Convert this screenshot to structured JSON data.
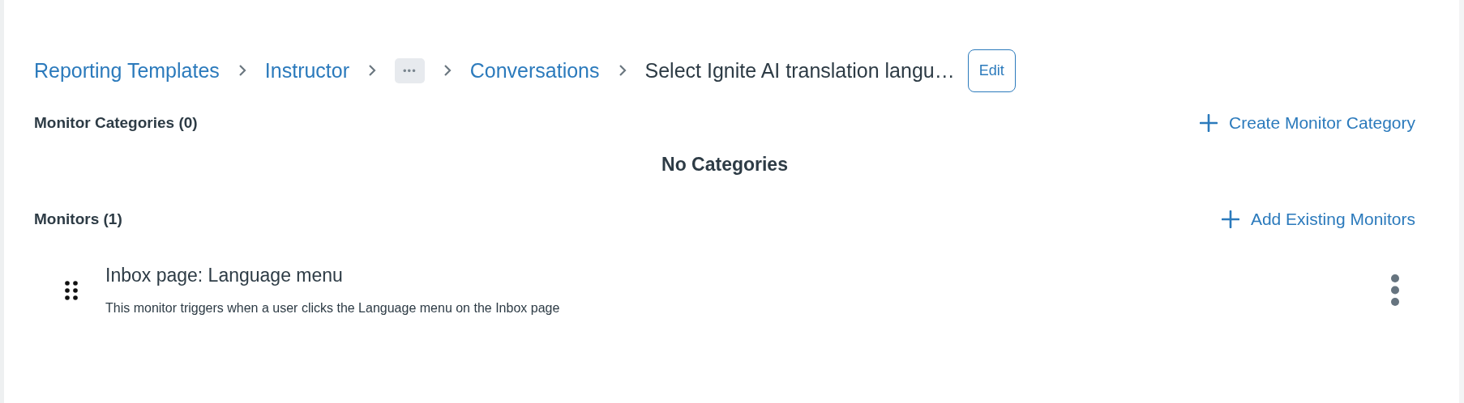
{
  "breadcrumb": [
    {
      "kind": "link",
      "label": "Reporting Templates"
    },
    {
      "kind": "link",
      "label": "Instructor"
    },
    {
      "kind": "ellipsis",
      "label": "•••"
    },
    {
      "kind": "link",
      "label": "Conversations"
    },
    {
      "kind": "current",
      "label": "Select Ignite AI translation langu…"
    }
  ],
  "edit_button": "Edit",
  "categories": {
    "heading": "Monitor Categories (0)",
    "action": "Create Monitor Category",
    "empty": "No Categories"
  },
  "monitors": {
    "heading": "Monitors (1)",
    "action": "Add Existing Monitors",
    "items": [
      {
        "title": "Inbox page: Language menu",
        "description": "This monitor triggers when a user clicks the Language menu on the Inbox page"
      }
    ]
  }
}
